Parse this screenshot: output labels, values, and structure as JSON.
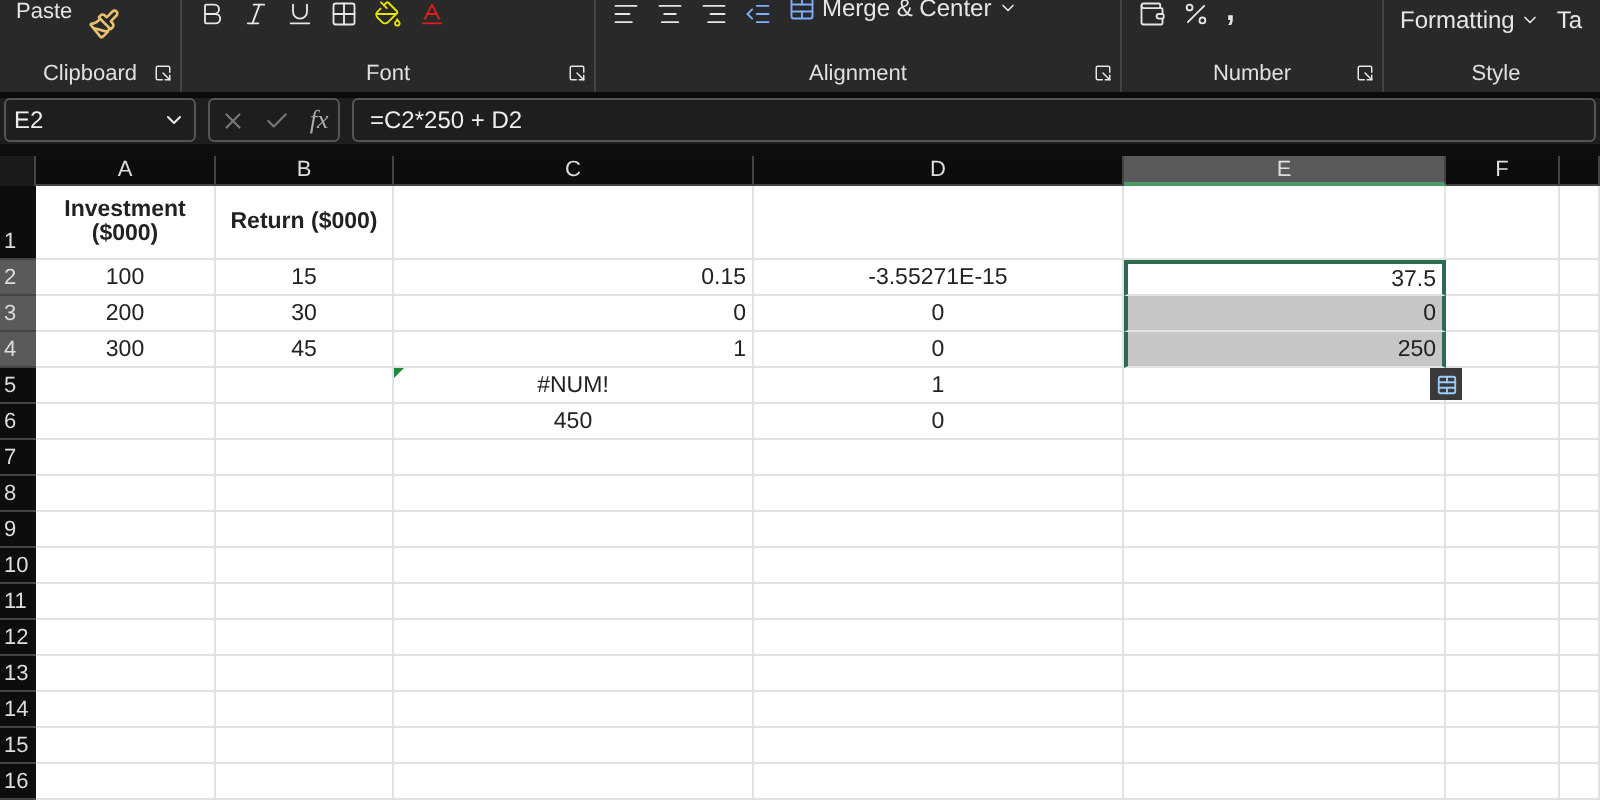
{
  "ribbon": {
    "groups": [
      {
        "kind": "clipboard",
        "label": "Clipboard",
        "button": "Paste"
      },
      {
        "kind": "font",
        "label": "Font"
      },
      {
        "kind": "alignment",
        "label": "Alignment",
        "button": "Merge & Center"
      },
      {
        "kind": "number",
        "label": "Number",
        "button": ","
      },
      {
        "kind": "styles",
        "label": "Style",
        "button": "Formatting",
        "extra": "Ta"
      }
    ]
  },
  "name_box": "E2",
  "function_label": "fx",
  "formula": "=C2*250 + D2",
  "columns": [
    {
      "label": "A",
      "selected": false
    },
    {
      "label": "B",
      "selected": false
    },
    {
      "label": "C",
      "selected": false
    },
    {
      "label": "D",
      "selected": false
    },
    {
      "label": "E",
      "selected": true
    },
    {
      "label": "F",
      "selected": false
    }
  ],
  "rows": [
    {
      "label": "1",
      "selected": false,
      "cells": [
        {
          "text": "Investment ($000)",
          "kind": "heading",
          "selected": false,
          "active": false,
          "flag": false
        },
        {
          "text": "Return ($000)",
          "kind": "heading",
          "selected": false,
          "active": false,
          "flag": false
        },
        null,
        null,
        null,
        null
      ]
    },
    {
      "label": "2",
      "selected": true,
      "cells": [
        {
          "text": "100",
          "kind": "centered",
          "selected": false,
          "active": false,
          "flag": false
        },
        {
          "text": "15",
          "kind": "centered",
          "selected": false,
          "active": false,
          "flag": false
        },
        {
          "text": "0.15",
          "kind": "numeric",
          "selected": false,
          "active": false,
          "flag": false
        },
        {
          "text": "-3.55271E-15",
          "kind": "centered",
          "selected": false,
          "active": false,
          "flag": false
        },
        {
          "text": "37.5",
          "kind": "numeric",
          "selected": true,
          "active": true,
          "flag": false
        },
        null
      ]
    },
    {
      "label": "3",
      "selected": true,
      "cells": [
        {
          "text": "200",
          "kind": "centered",
          "selected": false,
          "active": false,
          "flag": false
        },
        {
          "text": "30",
          "kind": "centered",
          "selected": false,
          "active": false,
          "flag": false
        },
        {
          "text": "0",
          "kind": "numeric",
          "selected": false,
          "active": false,
          "flag": false
        },
        {
          "text": "0",
          "kind": "centered",
          "selected": false,
          "active": false,
          "flag": false
        },
        {
          "text": "0",
          "kind": "numeric",
          "selected": true,
          "active": false,
          "flag": false
        },
        null
      ]
    },
    {
      "label": "4",
      "selected": true,
      "cells": [
        {
          "text": "300",
          "kind": "centered",
          "selected": false,
          "active": false,
          "flag": false
        },
        {
          "text": "45",
          "kind": "centered",
          "selected": false,
          "active": false,
          "flag": false
        },
        {
          "text": "1",
          "kind": "numeric",
          "selected": false,
          "active": false,
          "flag": false
        },
        {
          "text": "0",
          "kind": "centered",
          "selected": false,
          "active": false,
          "flag": false
        },
        {
          "text": "250",
          "kind": "numeric",
          "selected": true,
          "active": false,
          "flag": false
        },
        null
      ]
    },
    {
      "label": "5",
      "selected": false,
      "cells": [
        null,
        null,
        {
          "text": "#NUM!",
          "kind": "centered",
          "selected": false,
          "active": false,
          "flag": true
        },
        {
          "text": "1",
          "kind": "centered",
          "selected": false,
          "active": false,
          "flag": false
        },
        null,
        null
      ]
    },
    {
      "label": "6",
      "selected": false,
      "cells": [
        null,
        null,
        {
          "text": "450",
          "kind": "centered",
          "selected": false,
          "active": false,
          "flag": false
        },
        {
          "text": "0",
          "kind": "centered",
          "selected": false,
          "active": false,
          "flag": false
        },
        null,
        null
      ]
    },
    {
      "label": "7",
      "selected": false,
      "cells": [
        null,
        null,
        null,
        null,
        null,
        null
      ]
    },
    {
      "label": "8",
      "selected": false,
      "cells": [
        null,
        null,
        null,
        null,
        null,
        null
      ]
    },
    {
      "label": "9",
      "selected": false,
      "cells": [
        null,
        null,
        null,
        null,
        null,
        null
      ]
    },
    {
      "label": "10",
      "selected": false,
      "cells": [
        null,
        null,
        null,
        null,
        null,
        null
      ]
    },
    {
      "label": "11",
      "selected": false,
      "cells": [
        null,
        null,
        null,
        null,
        null,
        null
      ]
    },
    {
      "label": "12",
      "selected": false,
      "cells": [
        null,
        null,
        null,
        null,
        null,
        null
      ]
    },
    {
      "label": "13",
      "selected": false,
      "cells": [
        null,
        null,
        null,
        null,
        null,
        null
      ]
    },
    {
      "label": "14",
      "selected": false,
      "cells": [
        null,
        null,
        null,
        null,
        null,
        null
      ]
    },
    {
      "label": "15",
      "selected": false,
      "cells": [
        null,
        null,
        null,
        null,
        null,
        null
      ]
    },
    {
      "label": "16",
      "selected": false,
      "cells": [
        null,
        null,
        null,
        null,
        null,
        null
      ]
    }
  ]
}
